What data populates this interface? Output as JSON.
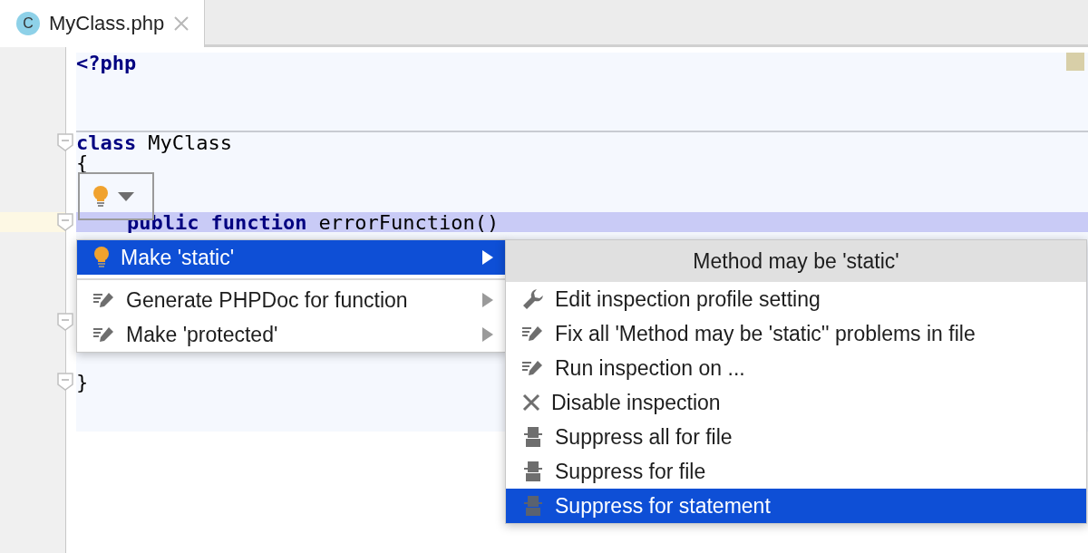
{
  "tabs": [
    {
      "icon_letter": "C",
      "label": "MyClass.php",
      "selected": true
    }
  ],
  "editor": {
    "lines": [
      {
        "kind": "code",
        "fold": false,
        "tokens": [
          {
            "text": "<?php",
            "kind": "keyword"
          }
        ]
      },
      {
        "kind": "blank"
      },
      {
        "kind": "blank"
      },
      {
        "kind": "separator"
      },
      {
        "kind": "code",
        "fold": true,
        "tokens": [
          {
            "text": "class",
            "kind": "keyword"
          },
          {
            "text": "MyClass",
            "kind": "plain"
          }
        ]
      },
      {
        "kind": "code",
        "fold": false,
        "tokens": [
          {
            "text": "{",
            "kind": "plain"
          }
        ]
      },
      {
        "kind": "blank"
      },
      {
        "kind": "blank"
      },
      {
        "kind": "body",
        "fold": true,
        "current": true,
        "tokens": [
          {
            "text": "public",
            "kind": "keyword"
          },
          {
            "text": "function",
            "kind": "keyword"
          },
          {
            "text": "errorFunction()",
            "kind": "plain"
          }
        ]
      },
      {
        "kind": "blank"
      },
      {
        "kind": "blank"
      },
      {
        "kind": "blank"
      },
      {
        "kind": "blank"
      },
      {
        "kind": "blank",
        "fold": true
      },
      {
        "kind": "blank"
      },
      {
        "kind": "blank"
      },
      {
        "kind": "code",
        "fold": true,
        "tokens": [
          {
            "text": "}",
            "kind": "plain"
          }
        ]
      }
    ]
  },
  "intention_menu": {
    "items": [
      {
        "label": "Make 'static'",
        "kind": "bulb",
        "selected": true
      },
      {
        "kind": "separator"
      },
      {
        "label": "Generate PHPDoc for function",
        "kind": "edit",
        "selected": false
      },
      {
        "label": "Make 'protected'",
        "kind": "edit",
        "selected": false
      }
    ]
  },
  "submenu": {
    "title": "Method may be 'static'",
    "items": [
      {
        "label": "Edit inspection profile setting",
        "kind": "wrench",
        "selected": false
      },
      {
        "label": "Fix all 'Method may be 'static'' problems in file",
        "kind": "edit",
        "selected": false
      },
      {
        "label": "Run inspection on ...",
        "kind": "edit",
        "selected": false
      },
      {
        "label": "Disable inspection",
        "kind": "cross",
        "selected": false
      },
      {
        "label": "Suppress all for file",
        "kind": "suppress",
        "selected": false
      },
      {
        "label": "Suppress for file",
        "kind": "suppress",
        "selected": false
      },
      {
        "label": "Suppress for statement",
        "kind": "suppress",
        "selected": true
      }
    ]
  }
}
